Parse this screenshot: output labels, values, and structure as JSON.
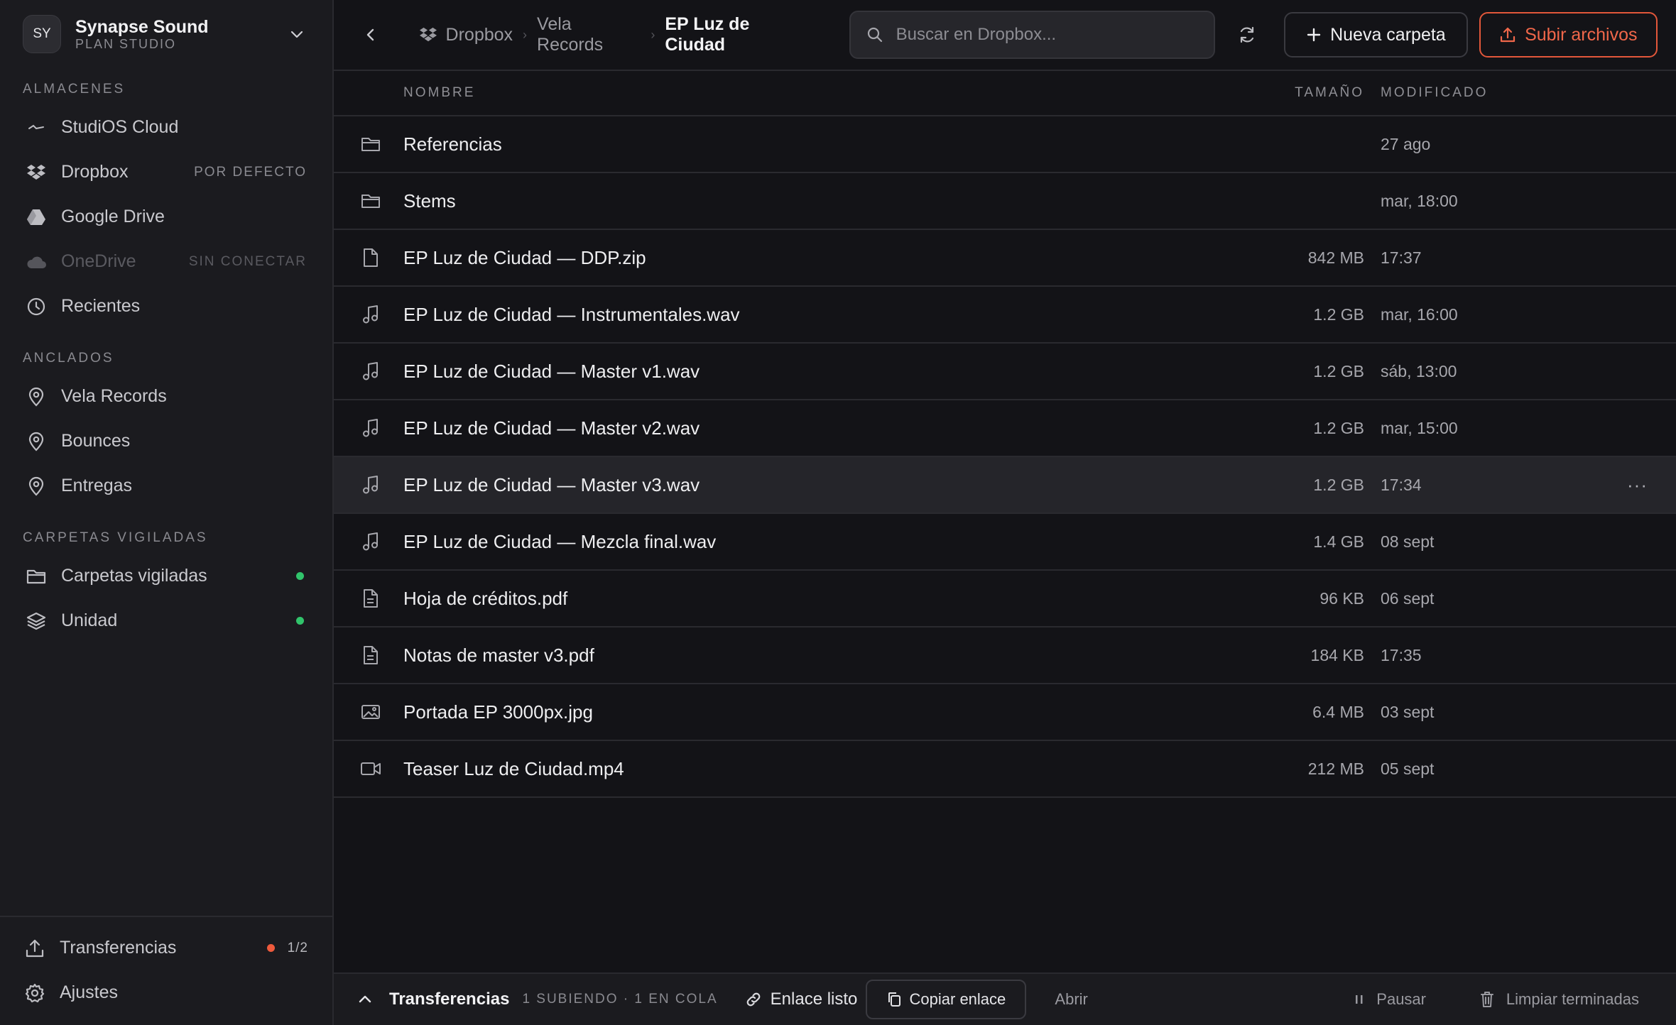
{
  "org": {
    "initials": "SY",
    "name": "Synapse Sound",
    "plan": "PLAN STUDIO"
  },
  "sidebar": {
    "storage_label": "ALMACENES",
    "storage": [
      {
        "label": "StudiOS Cloud",
        "icon": "studios-cloud-icon",
        "tag": ""
      },
      {
        "label": "Dropbox",
        "icon": "dropbox-icon",
        "tag": "POR DEFECTO"
      },
      {
        "label": "Google Drive",
        "icon": "google-drive-icon",
        "tag": ""
      },
      {
        "label": "OneDrive",
        "icon": "onedrive-icon",
        "tag": "SIN CONECTAR"
      },
      {
        "label": "Recientes",
        "icon": "clock-icon",
        "tag": ""
      }
    ],
    "pinned_label": "ANCLADOS",
    "pinned": [
      {
        "label": "Vela Records",
        "icon": "pin-icon"
      },
      {
        "label": "Bounces",
        "icon": "pin-icon"
      },
      {
        "label": "Entregas",
        "icon": "pin-icon"
      }
    ],
    "watched_label": "CARPETAS VIGILADAS",
    "watched": [
      {
        "label": "Carpetas vigiladas",
        "icon": "folder-icon",
        "status": "online"
      },
      {
        "label": "Unidad",
        "icon": "layers-icon",
        "status": "online"
      }
    ],
    "bottom": {
      "transfers_label": "Transferencias",
      "transfers_count": "1/2",
      "settings_label": "Ajustes"
    }
  },
  "header": {
    "breadcrumb": [
      "Dropbox",
      "Vela Records",
      "EP Luz de Ciudad"
    ],
    "search_placeholder": "Buscar en Dropbox...",
    "new_folder_label": "Nueva carpeta",
    "upload_label": "Subir archivos"
  },
  "table": {
    "columns": {
      "name": "NOMBRE",
      "size": "TAMAÑO",
      "modified": "MODIFICADO"
    },
    "rows": [
      {
        "name": "Referencias",
        "size": "",
        "modified": "27 ago",
        "icon": "folder-icon"
      },
      {
        "name": "Stems",
        "size": "",
        "modified": "mar, 18:00",
        "icon": "folder-icon"
      },
      {
        "name": "EP Luz de Ciudad — DDP.zip",
        "size": "842 MB",
        "modified": "17:37",
        "icon": "file-icon"
      },
      {
        "name": "EP Luz de Ciudad — Instrumentales.wav",
        "size": "1.2 GB",
        "modified": "mar, 16:00",
        "icon": "music-note-icon"
      },
      {
        "name": "EP Luz de Ciudad — Master v1.wav",
        "size": "1.2 GB",
        "modified": "sáb, 13:00",
        "icon": "music-note-icon"
      },
      {
        "name": "EP Luz de Ciudad — Master v2.wav",
        "size": "1.2 GB",
        "modified": "mar, 15:00",
        "icon": "music-note-icon"
      },
      {
        "name": "EP Luz de Ciudad — Master v3.wav",
        "size": "1.2 GB",
        "modified": "17:34",
        "icon": "music-note-icon",
        "selected": true,
        "more": "···"
      },
      {
        "name": "EP Luz de Ciudad — Mezcla final.wav",
        "size": "1.4 GB",
        "modified": "08 sept",
        "icon": "music-note-icon"
      },
      {
        "name": "Hoja de créditos.pdf",
        "size": "96 KB",
        "modified": "06 sept",
        "icon": "document-icon"
      },
      {
        "name": "Notas de master v3.pdf",
        "size": "184 KB",
        "modified": "17:35",
        "icon": "document-icon"
      },
      {
        "name": "Portada EP 3000px.jpg",
        "size": "6.4 MB",
        "modified": "03 sept",
        "icon": "image-icon"
      },
      {
        "name": "Teaser Luz de Ciudad.mp4",
        "size": "212 MB",
        "modified": "05 sept",
        "icon": "video-icon"
      }
    ]
  },
  "transfer_bar": {
    "title": "Transferencias",
    "status": "1 SUBIENDO · 1 EN COLA",
    "link_ready": "Enlace listo",
    "copy_link": "Copiar enlace",
    "open": "Abrir",
    "pause": "Pausar",
    "clear": "Limpiar terminadas"
  },
  "colors": {
    "accent": "#f0674a",
    "online": "#31c46b",
    "alert": "#ee5a3c",
    "background": "#131317",
    "sidebar": "#1b1b1f"
  }
}
